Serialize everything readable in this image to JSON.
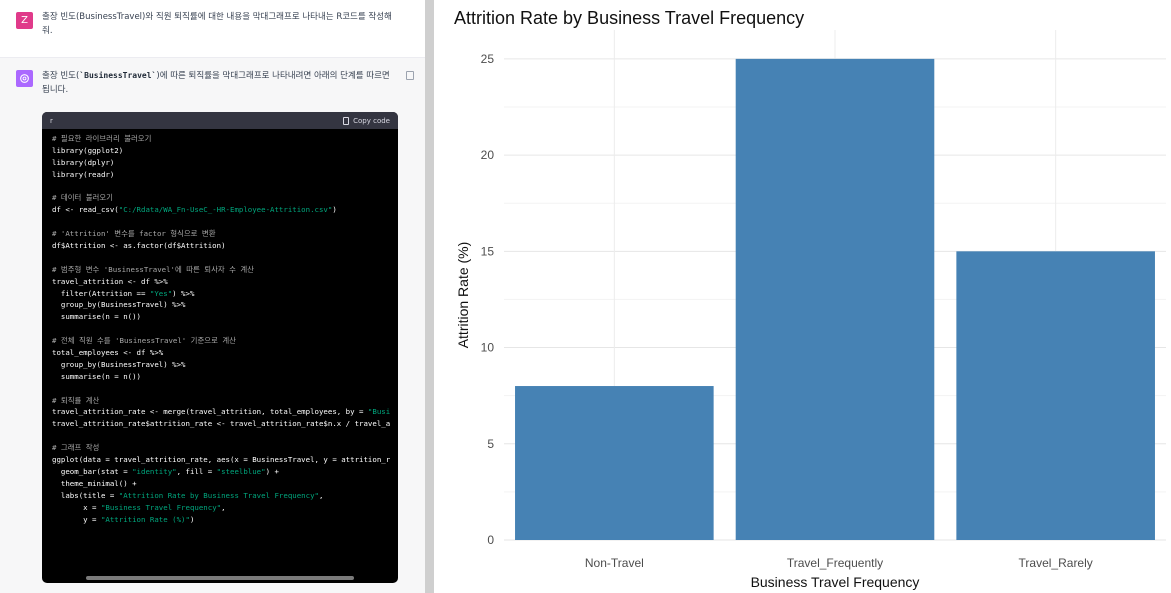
{
  "chat": {
    "user_avatar": "Z",
    "user_message": "출장 빈도(BusinessTravel)와 직원 퇴직률에 대한 내용을 막대그래프로 나타내는 R코드를 작성해줘.",
    "assistant_intro_pre": "출장 빈도(",
    "assistant_intro_code": "`BusinessTravel`",
    "assistant_intro_post": ")에 따른 퇴직률을 막대그래프로 나타내려면 아래의 단계를 따르면 됩니다.",
    "code_language": "r",
    "copy_label": "Copy code",
    "code_lines": [
      {
        "t": "# 필요한 라이브러리 불러오기",
        "c": "comment"
      },
      {
        "t": "library(ggplot2)",
        "c": ""
      },
      {
        "t": "library(dplyr)",
        "c": ""
      },
      {
        "t": "library(readr)",
        "c": ""
      },
      {
        "t": "",
        "c": "blank"
      },
      {
        "t": "# 데이터 불러오기",
        "c": "comment"
      },
      {
        "t": "df <- read_csv(",
        "s": "\"C:/Rdata/WA_Fn-UseC_-HR-Employee-Attrition.csv\"",
        "a": ")",
        "c": ""
      },
      {
        "t": "",
        "c": "blank"
      },
      {
        "t": "# 'Attrition' 변수를 factor 형식으로 변환",
        "c": "comment"
      },
      {
        "t": "df$Attrition <- as.factor(df$Attrition)",
        "c": ""
      },
      {
        "t": "",
        "c": "blank"
      },
      {
        "t": "# 범주형 변수 'BusinessTravel'에 따른 퇴사자 수 계산",
        "c": "comment"
      },
      {
        "t": "travel_attrition <- df %>%",
        "c": ""
      },
      {
        "t": "  filter(Attrition == ",
        "s": "\"Yes\"",
        "a": ") %>%",
        "c": ""
      },
      {
        "t": "  group_by(BusinessTravel) %>%",
        "c": ""
      },
      {
        "t": "  summarise(n = n())",
        "c": ""
      },
      {
        "t": "",
        "c": "blank"
      },
      {
        "t": "# 전체 직원 수를 'BusinessTravel' 기준으로 계산",
        "c": "comment"
      },
      {
        "t": "total_employees <- df %>%",
        "c": ""
      },
      {
        "t": "  group_by(BusinessTravel) %>%",
        "c": ""
      },
      {
        "t": "  summarise(n = n())",
        "c": ""
      },
      {
        "t": "",
        "c": "blank"
      },
      {
        "t": "# 퇴직률 계산",
        "c": "comment"
      },
      {
        "t": "travel_attrition_rate <- merge(travel_attrition, total_employees, by = ",
        "s": "\"Busi",
        "a": "",
        "c": ""
      },
      {
        "t": "travel_attrition_rate$attrition_rate <- travel_attrition_rate$n.x / travel_a",
        "c": ""
      },
      {
        "t": "",
        "c": "blank"
      },
      {
        "t": "# 그래프 작성",
        "c": "comment"
      },
      {
        "t": "ggplot(data = travel_attrition_rate, aes(x = BusinessTravel, y = attrition_r",
        "c": ""
      },
      {
        "t": "  geom_bar(stat = ",
        "s": "\"identity\"",
        "a": ", fill = ",
        "s2": "\"steelblue\"",
        "a2": ") +",
        "c": ""
      },
      {
        "t": "  theme_minimal() +",
        "c": ""
      },
      {
        "t": "  labs(title = ",
        "s": "\"Attrition Rate by Business Travel Frequency\"",
        "a": ",",
        "c": ""
      },
      {
        "t": "       x = ",
        "s": "\"Business Travel Frequency\"",
        "a": ",",
        "c": ""
      },
      {
        "t": "       y = ",
        "s": "\"Attrition Rate (%)\"",
        "a": ")",
        "c": ""
      }
    ]
  },
  "chart_data": {
    "type": "bar",
    "title": "Attrition Rate by Business Travel Frequency",
    "xlabel": "Business Travel Frequency",
    "ylabel": "Attrition Rate (%)",
    "categories": [
      "Non-Travel",
      "Travel_Frequently",
      "Travel_Rarely"
    ],
    "values": [
      8,
      25,
      15
    ],
    "ylim": [
      0,
      26.5
    ],
    "yticks": [
      0,
      5,
      10,
      15,
      20,
      25
    ],
    "bar_color": "#4682b4",
    "grid": true,
    "theme": "minimal"
  }
}
